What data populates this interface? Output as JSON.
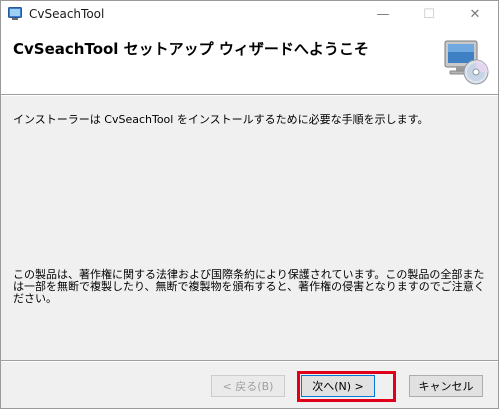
{
  "window": {
    "title": "CvSeachTool",
    "controls": {
      "minimize": "—",
      "maximize": "☐",
      "close": "✕"
    }
  },
  "banner": {
    "title": "CvSeachTool セットアップ ウィザードへようこそ",
    "icon": "computer-cd-icon"
  },
  "content": {
    "intro": "インストーラーは CvSeachTool をインストールするために必要な手順を示します。",
    "legal": "この製品は、著作権に関する法律および国際条約により保護されています。この製品の全部または一部を無断で複製したり、無断で複製物を頒布すると、著作権の侵害となりますのでご注意ください。"
  },
  "buttons": {
    "back": "< 戻る(B)",
    "next": "次へ(N) >",
    "cancel": "キャンセル"
  },
  "colors": {
    "highlight": "#e0001b",
    "focus": "#0078d7"
  }
}
